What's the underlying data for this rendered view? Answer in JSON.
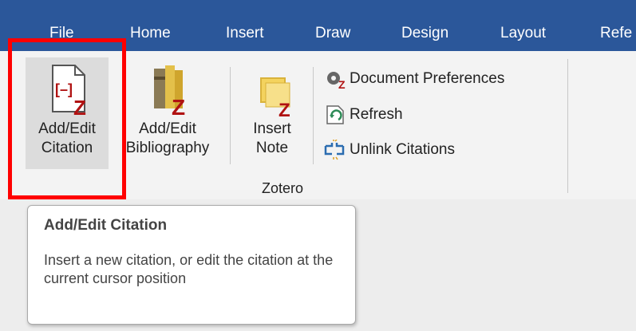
{
  "tabs": [
    {
      "label": "File"
    },
    {
      "label": "Home"
    },
    {
      "label": "Insert"
    },
    {
      "label": "Draw"
    },
    {
      "label": "Design"
    },
    {
      "label": "Layout"
    },
    {
      "label": "Refe"
    }
  ],
  "ribbon": {
    "add_edit_citation": {
      "line1": "Add/Edit",
      "line2": "Citation"
    },
    "add_edit_bibliography": {
      "line1": "Add/Edit",
      "line2": "Bibliography"
    },
    "insert_note": {
      "line1": "Insert",
      "line2": "Note"
    },
    "document_preferences": "Document Preferences",
    "refresh": "Refresh",
    "unlink_citations": "Unlink Citations",
    "group_label": "Zotero"
  },
  "tooltip": {
    "title": "Add/Edit Citation",
    "body": "Insert a new citation, or edit the citation at the current cursor position"
  },
  "colors": {
    "tab_bar": "#2b579a",
    "highlight": "#ff0000",
    "zotero_red": "#b01212"
  },
  "icons": {
    "add_edit_citation": "citation-document-icon",
    "add_edit_bibliography": "bibliography-books-icon",
    "insert_note": "note-icon",
    "document_preferences": "gear-icon",
    "refresh": "refresh-icon",
    "unlink_citations": "unlink-icon"
  }
}
